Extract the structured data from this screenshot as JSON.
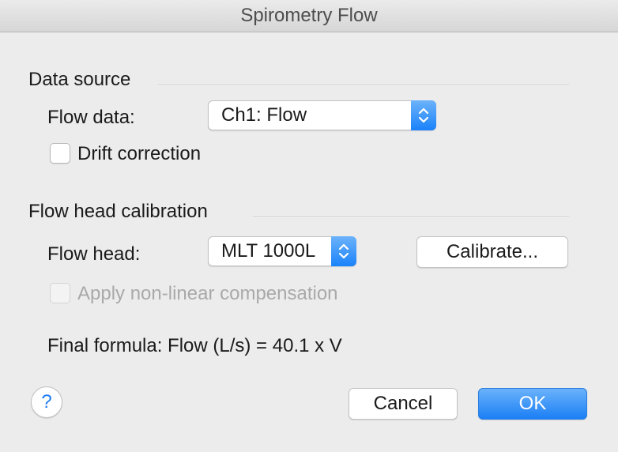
{
  "window": {
    "title": "Spirometry Flow"
  },
  "data_source": {
    "heading": "Data source",
    "flow_data_label": "Flow data:",
    "flow_data_value": "Ch1: Flow",
    "drift_correction_label": "Drift correction",
    "drift_correction_checked": false
  },
  "calibration": {
    "heading": "Flow head calibration",
    "flow_head_label": "Flow head:",
    "flow_head_value": "MLT 1000L",
    "calibrate_label": "Calibrate...",
    "nonlinear_label": "Apply non-linear compensation",
    "nonlinear_checked": false,
    "nonlinear_enabled": false
  },
  "formula": {
    "text": "Final formula: Flow (L/s) = 40.1 x V"
  },
  "footer": {
    "help_label": "?",
    "cancel_label": "Cancel",
    "ok_label": "OK"
  },
  "colors": {
    "accent": "#1b7ff5",
    "help_glyph": "#1f7bf5",
    "disabled_text": "#a9a9a9"
  }
}
